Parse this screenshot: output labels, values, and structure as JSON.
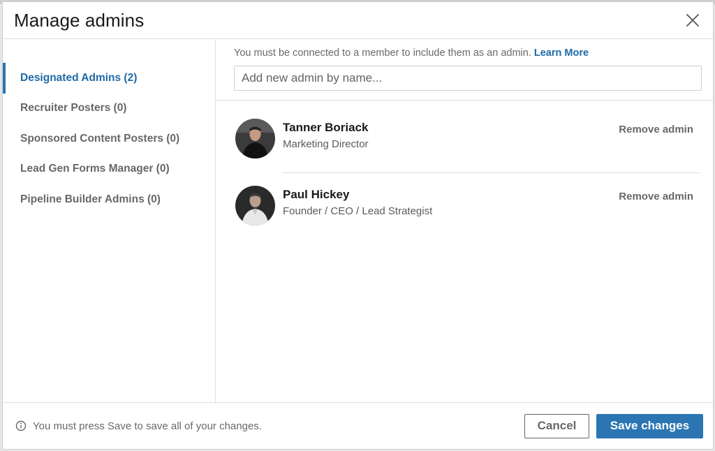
{
  "modal": {
    "title": "Manage admins"
  },
  "sidebar": {
    "items": [
      {
        "label": "Designated Admins (2)",
        "active": true
      },
      {
        "label": "Recruiter Posters (0)"
      },
      {
        "label": "Sponsored Content Posters (0)"
      },
      {
        "label": "Lead Gen Forms Manager (0)"
      },
      {
        "label": "Pipeline Builder Admins (0)"
      }
    ]
  },
  "main": {
    "notice_text": "You must be connected to a member to include them as an admin.",
    "learn_more": "Learn More",
    "search_placeholder": "Add new admin by name...",
    "admins": [
      {
        "name": "Tanner Boriack",
        "role": "Marketing Director",
        "remove_label": "Remove admin"
      },
      {
        "name": "Paul Hickey",
        "role": "Founder / CEO / Lead Strategist",
        "remove_label": "Remove admin"
      }
    ]
  },
  "footer": {
    "note": "You must press Save to save all of your changes.",
    "cancel_label": "Cancel",
    "save_label": "Save changes"
  },
  "colors": {
    "accent": "#2b75b3",
    "link": "#1e6aa8"
  }
}
